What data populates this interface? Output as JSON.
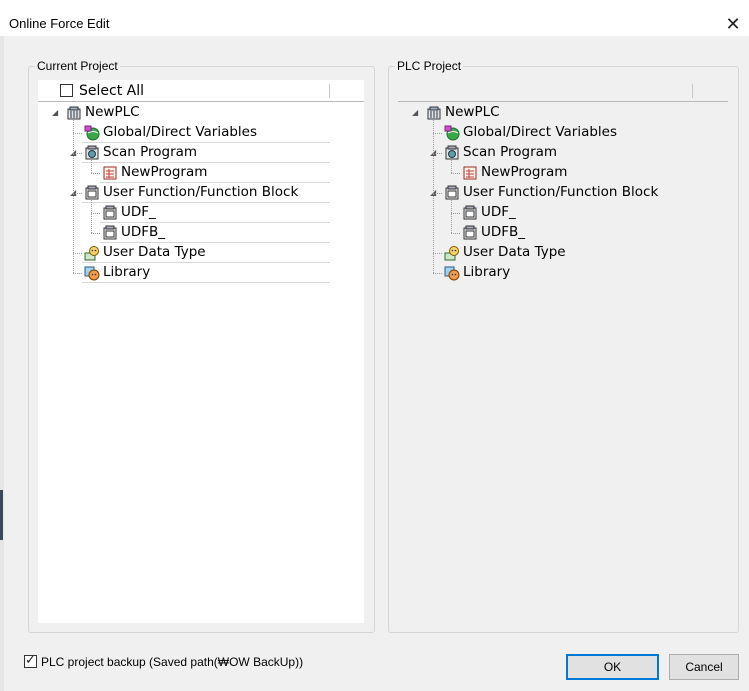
{
  "window": {
    "title": "Online Force Edit",
    "close_glyph": "✕"
  },
  "current_project": {
    "group_label": "Current Project",
    "select_all_label": "Select All",
    "select_all_checked": false,
    "tree": [
      {
        "label": "NewPLC",
        "icon": "plc-icon",
        "level": 0,
        "expanded": true
      },
      {
        "label": "Global/Direct Variables",
        "icon": "globe-variables-icon",
        "level": 1
      },
      {
        "label": "Scan Program",
        "icon": "scan-program-icon",
        "level": 1,
        "expanded": true
      },
      {
        "label": "NewProgram",
        "icon": "program-icon",
        "level": 2
      },
      {
        "label": "User Function/Function Block",
        "icon": "function-block-icon",
        "level": 1,
        "expanded": true
      },
      {
        "label": "UDF_",
        "icon": "udf-icon",
        "level": 2
      },
      {
        "label": "UDFB_",
        "icon": "udfb-icon",
        "level": 2
      },
      {
        "label": "User Data Type",
        "icon": "data-type-icon",
        "level": 1
      },
      {
        "label": "Library",
        "icon": "library-icon",
        "level": 1
      }
    ]
  },
  "plc_project": {
    "group_label": "PLC Project",
    "tree": [
      {
        "label": "NewPLC",
        "icon": "plc-icon",
        "level": 0,
        "expanded": true
      },
      {
        "label": "Global/Direct Variables",
        "icon": "globe-variables-icon",
        "level": 1
      },
      {
        "label": "Scan Program",
        "icon": "scan-program-icon",
        "level": 1,
        "expanded": true
      },
      {
        "label": "NewProgram",
        "icon": "program-icon",
        "level": 2
      },
      {
        "label": "User Function/Function Block",
        "icon": "function-block-icon",
        "level": 1,
        "expanded": true
      },
      {
        "label": "UDF_",
        "icon": "udf-icon",
        "level": 2
      },
      {
        "label": "UDFB_",
        "icon": "udfb-icon",
        "level": 2
      },
      {
        "label": "User Data Type",
        "icon": "data-type-icon",
        "level": 1
      },
      {
        "label": "Library",
        "icon": "library-icon",
        "level": 1
      }
    ]
  },
  "footer": {
    "backup_label": "PLC project backup (Saved path(₩OW BackUp))",
    "backup_checked": true,
    "ok_label": "OK",
    "cancel_label": "Cancel"
  },
  "colors": {
    "accent": "#0078d7",
    "dialog_bg": "#f0f0f0"
  }
}
